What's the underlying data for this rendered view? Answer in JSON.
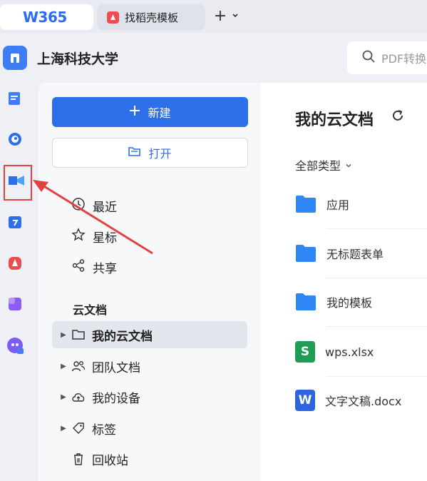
{
  "tabs": {
    "app_logo": "W365",
    "doc_tab_label": "找稻壳模板",
    "add_tab": "+"
  },
  "header": {
    "org_name": "上海科技大学",
    "search_placeholder": "PDF转换"
  },
  "rail": {
    "icons": [
      "org-logo-icon",
      "document-icon",
      "chat-icon",
      "meeting-icon",
      "calendar-icon",
      "docer-icon",
      "app-square-icon",
      "ai-assistant-icon"
    ],
    "highlight_color": "#e0433f"
  },
  "sidebar": {
    "new_label": "新建",
    "open_label": "打开",
    "nav": [
      {
        "label": "最近",
        "icon": "clock-icon"
      },
      {
        "label": "星标",
        "icon": "star-icon"
      },
      {
        "label": "共享",
        "icon": "share-icon"
      }
    ],
    "section_title": "云文档",
    "tree": [
      {
        "label": "我的云文档",
        "icon": "folder-icon",
        "active": true
      },
      {
        "label": "团队文档",
        "icon": "team-icon",
        "active": false
      },
      {
        "label": "我的设备",
        "icon": "cloud-icon",
        "active": false
      },
      {
        "label": "标签",
        "icon": "tag-icon",
        "active": false
      },
      {
        "label": "回收站",
        "icon": "trash-icon",
        "active": false
      }
    ]
  },
  "main": {
    "title": "我的云文档",
    "filter_label": "全部类型",
    "files": [
      {
        "name": "应用",
        "type": "folder"
      },
      {
        "name": "无标题表单",
        "type": "folder"
      },
      {
        "name": "我的模板",
        "type": "folder"
      },
      {
        "name": "wps.xlsx",
        "type": "xlsx",
        "badge": "S"
      },
      {
        "name": "文字文稿.docx",
        "type": "docx",
        "badge": "W"
      }
    ]
  },
  "colors": {
    "accent": "#2d6fe8",
    "folder": "#2f86f6",
    "annotation": "#e0433f"
  }
}
